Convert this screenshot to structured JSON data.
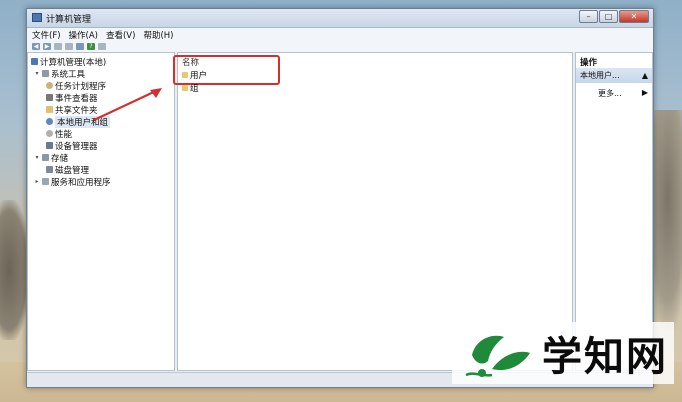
{
  "window": {
    "title": "计算机管理",
    "controls": {
      "minimize": "–",
      "maximize": "□",
      "close": "✕"
    }
  },
  "menu": [
    "文件(F)",
    "操作(A)",
    "查看(V)",
    "帮助(H)"
  ],
  "tree": {
    "items": [
      {
        "label": "计算机管理(本地)",
        "icon": "computer-management-icon"
      },
      {
        "label": "系统工具",
        "icon": "system-tools-icon",
        "expander": "▾"
      },
      {
        "label": "任务计划程序",
        "icon": "task-scheduler-icon"
      },
      {
        "label": "事件查看器",
        "icon": "event-viewer-icon"
      },
      {
        "label": "共享文件夹",
        "icon": "shared-folder-icon"
      },
      {
        "label": "本地用户和组",
        "icon": "local-users-groups-icon",
        "selected": true
      },
      {
        "label": "性能",
        "icon": "performance-icon"
      },
      {
        "label": "设备管理器",
        "icon": "device-manager-icon"
      },
      {
        "label": "存储",
        "icon": "storage-icon",
        "expander": "▾"
      },
      {
        "label": "磁盘管理",
        "icon": "disk-management-icon"
      },
      {
        "label": "服务和应用程序",
        "icon": "services-apps-icon",
        "expander": "▸"
      }
    ]
  },
  "list": {
    "column_header": "名称",
    "rows": [
      {
        "label": "用户",
        "icon": "users-folder-icon"
      },
      {
        "label": "组",
        "icon": "groups-folder-icon"
      }
    ]
  },
  "actions": {
    "title": "操作",
    "section_label": "本地用户...",
    "section_caret": "▲",
    "more_label": "更多...",
    "more_caret": "▶"
  },
  "watermark": {
    "text": "学知网"
  },
  "colors": {
    "highlight": "#d32f2f",
    "accent": "#4b79b2",
    "logo_green": "#1f8a3a"
  }
}
